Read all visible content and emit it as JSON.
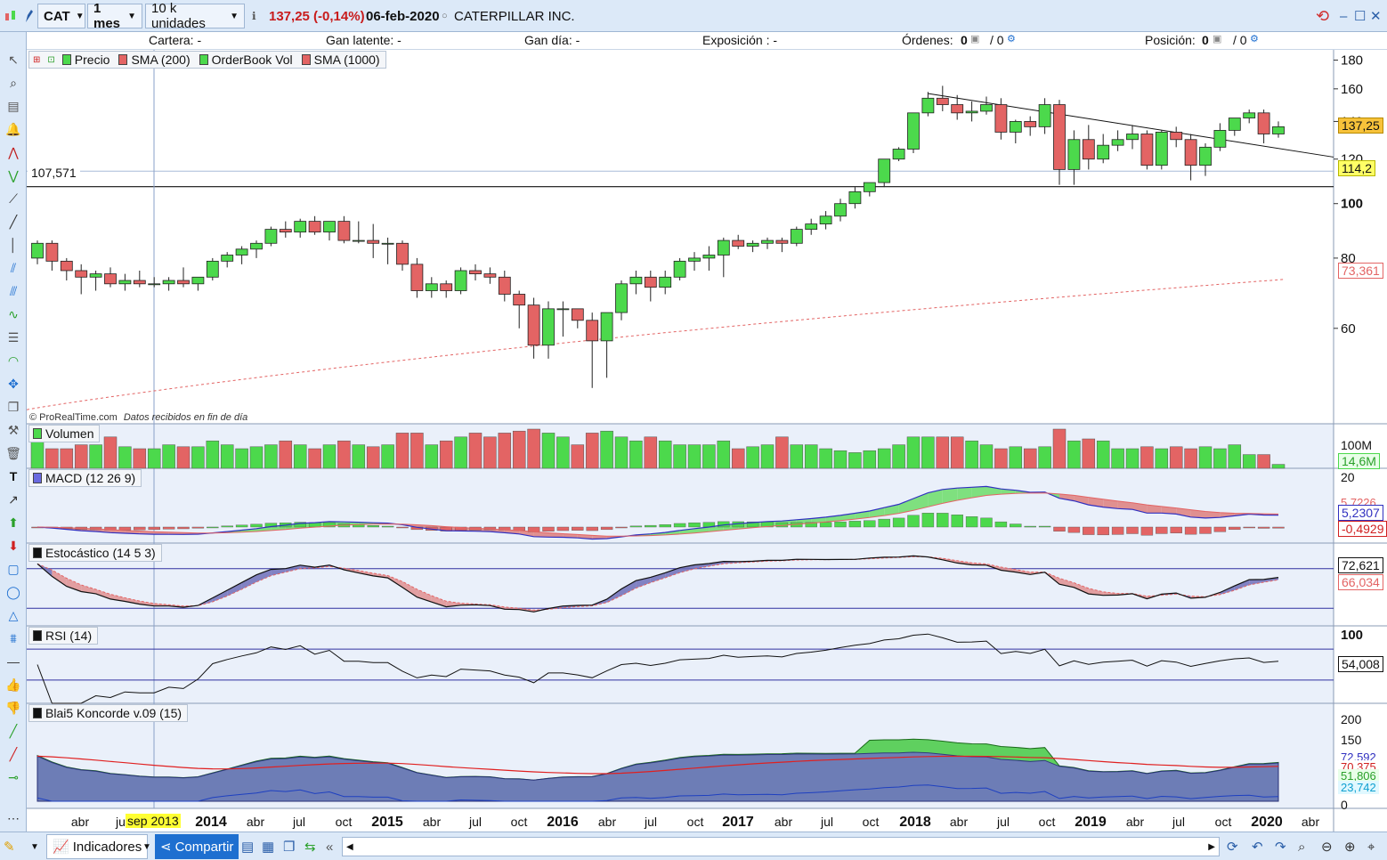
{
  "toolbar": {
    "symbol": "CAT",
    "timeframe": "1 mes",
    "units": "10 k unidades",
    "price_change": "137,25 (-0,14%)",
    "date": "06-feb-2020",
    "instrument": "CATERPILLAR INC."
  },
  "infobar": {
    "cartera": "Cartera: -",
    "gan_latente": "Gan latente: -",
    "gan_dia": "Gan día: -",
    "exposicion": "Exposición : -",
    "ordenes_label": "Órdenes:",
    "ordenes_a": "0",
    "ordenes_b": "/ 0",
    "posicion_label": "Posición:",
    "posicion_a": "0",
    "posicion_b": "/ 0"
  },
  "legend_price": {
    "precio": "Precio",
    "sma200": "SMA (200)",
    "orderbook": "OrderBook Vol",
    "sma1000": "SMA (1000)"
  },
  "price_panel": {
    "yticks": [
      "180",
      "160",
      "140",
      "120",
      "100",
      "80",
      "60"
    ],
    "hline_label": "107,571",
    "last_price": "137,25",
    "level_114": "114,2",
    "sma_value": "73,361",
    "watermark": "© ProRealTime.com",
    "watermark_sub": "Datos recibidos en fin de día"
  },
  "volume_panel": {
    "title": "Volumen",
    "ytick": "100M",
    "value": "14,6M"
  },
  "macd_panel": {
    "title": "MACD (12 26 9)",
    "ytick": "20",
    "v1": "5,7226",
    "v2": "5,2307",
    "v3": "-0,4929"
  },
  "stoch_panel": {
    "title": "Estocástico (14 5 3)",
    "v1": "72,621",
    "v2": "66,034"
  },
  "rsi_panel": {
    "title": "RSI (14)",
    "ytick": "100",
    "value": "54,008"
  },
  "koncorde_panel": {
    "title": "Blai5 Koncorde v.09 (15)",
    "yticks": [
      "200",
      "150",
      "0"
    ],
    "v1": "72,592",
    "v2": "70,375",
    "v3": "51,806",
    "v4": "23,742"
  },
  "xaxis": {
    "labels": [
      "abr",
      "jul",
      "2014",
      "abr",
      "jul",
      "oct",
      "2015",
      "abr",
      "jul",
      "oct",
      "2016",
      "abr",
      "jul",
      "oct",
      "2017",
      "abr",
      "jul",
      "oct",
      "2018",
      "abr",
      "jul",
      "oct",
      "2019",
      "abr",
      "jul",
      "oct",
      "2020",
      "abr"
    ],
    "cursor_label": "sep 2013"
  },
  "bottombar": {
    "indicadores": "Indicadores",
    "compartir": "Compartir"
  },
  "colors": {
    "up": "#4cd94c",
    "down": "#e36464",
    "accent": "#1e6fd0"
  },
  "chart_data": {
    "type": "candlestick",
    "title": "",
    "ylim": [
      40,
      185
    ],
    "ohlc": [
      [
        80,
        86,
        78,
        85
      ],
      [
        85,
        86,
        76,
        79
      ],
      [
        79,
        80,
        73,
        76
      ],
      [
        76,
        78,
        69,
        74
      ],
      [
        74,
        76,
        70,
        75
      ],
      [
        75,
        77,
        71,
        72
      ],
      [
        72,
        75,
        70,
        73
      ],
      [
        73,
        76,
        71,
        72
      ],
      [
        72,
        74,
        71,
        72
      ],
      [
        72,
        74,
        70,
        73
      ],
      [
        73,
        77,
        71,
        72
      ],
      [
        72,
        74,
        70,
        74
      ],
      [
        74,
        80,
        73,
        79
      ],
      [
        79,
        82,
        77,
        81
      ],
      [
        81,
        84,
        78,
        83
      ],
      [
        83,
        86,
        80,
        85
      ],
      [
        85,
        91,
        84,
        90
      ],
      [
        90,
        93,
        87,
        89
      ],
      [
        89,
        94,
        87,
        93
      ],
      [
        93,
        95,
        88,
        89
      ],
      [
        89,
        93,
        86,
        93
      ],
      [
        93,
        95,
        85,
        86
      ],
      [
        86,
        93,
        85,
        86
      ],
      [
        86,
        92,
        80,
        85
      ],
      [
        85,
        87,
        78,
        85
      ],
      [
        85,
        86,
        76,
        78
      ],
      [
        78,
        80,
        68,
        70
      ],
      [
        70,
        74,
        68,
        72
      ],
      [
        72,
        73,
        68,
        70
      ],
      [
        70,
        77,
        69,
        76
      ],
      [
        76,
        78,
        73,
        75
      ],
      [
        75,
        77,
        72,
        74
      ],
      [
        74,
        76,
        67,
        69
      ],
      [
        69,
        70,
        60,
        66
      ],
      [
        66,
        68,
        53,
        56
      ],
      [
        56,
        67,
        53,
        65
      ],
      [
        65,
        67,
        58,
        65
      ],
      [
        65,
        64,
        60,
        62
      ],
      [
        62,
        64,
        47,
        57
      ],
      [
        57,
        64,
        49,
        64
      ],
      [
        64,
        73,
        62,
        72
      ],
      [
        72,
        76,
        69,
        74
      ],
      [
        74,
        76,
        67,
        71
      ],
      [
        71,
        76,
        69,
        74
      ],
      [
        74,
        80,
        73,
        79
      ],
      [
        79,
        82,
        76,
        80
      ],
      [
        80,
        84,
        76,
        81
      ],
      [
        81,
        87,
        74,
        86
      ],
      [
        86,
        88,
        83,
        84
      ],
      [
        84,
        86,
        82,
        85
      ],
      [
        85,
        87,
        83,
        86
      ],
      [
        86,
        87,
        82,
        85
      ],
      [
        85,
        91,
        84,
        90
      ],
      [
        90,
        94,
        88,
        92
      ],
      [
        92,
        97,
        90,
        95
      ],
      [
        95,
        102,
        93,
        100
      ],
      [
        100,
        107,
        98,
        105
      ],
      [
        105,
        109,
        103,
        109
      ],
      [
        109,
        120,
        107,
        120
      ],
      [
        120,
        126,
        119,
        125
      ],
      [
        125,
        143,
        123,
        145
      ],
      [
        145,
        158,
        143,
        154
      ],
      [
        154,
        162,
        146,
        150
      ],
      [
        150,
        156,
        141,
        145
      ],
      [
        145,
        152,
        140,
        146
      ],
      [
        146,
        155,
        144,
        150
      ],
      [
        150,
        154,
        130,
        134
      ],
      [
        134,
        141,
        128,
        140
      ],
      [
        140,
        143,
        132,
        137
      ],
      [
        137,
        154,
        133,
        150
      ],
      [
        150,
        153,
        108,
        115
      ],
      [
        115,
        135,
        108,
        130
      ],
      [
        130,
        138,
        115,
        120
      ],
      [
        120,
        133,
        118,
        127
      ],
      [
        127,
        135,
        124,
        130
      ],
      [
        130,
        138,
        125,
        133
      ],
      [
        133,
        135,
        115,
        117
      ],
      [
        117,
        135,
        115,
        134
      ],
      [
        134,
        137,
        126,
        130
      ],
      [
        130,
        133,
        110,
        117
      ],
      [
        117,
        128,
        112,
        126
      ],
      [
        126,
        139,
        124,
        135
      ],
      [
        135,
        141,
        132,
        142
      ],
      [
        142,
        147,
        139,
        145
      ],
      [
        145,
        147,
        128,
        133
      ],
      [
        133,
        140,
        131,
        137
      ]
    ],
    "volume_rel": [
      0.7,
      0.5,
      0.5,
      0.6,
      0.6,
      0.8,
      0.55,
      0.5,
      0.5,
      0.6,
      0.55,
      0.55,
      0.7,
      0.6,
      0.5,
      0.55,
      0.6,
      0.7,
      0.6,
      0.5,
      0.6,
      0.7,
      0.6,
      0.55,
      0.6,
      0.9,
      0.9,
      0.6,
      0.7,
      0.8,
      0.9,
      0.8,
      0.9,
      0.95,
      1.0,
      0.9,
      0.8,
      0.6,
      0.9,
      0.95,
      0.8,
      0.7,
      0.8,
      0.7,
      0.6,
      0.6,
      0.6,
      0.7,
      0.5,
      0.55,
      0.6,
      0.8,
      0.6,
      0.6,
      0.5,
      0.45,
      0.4,
      0.45,
      0.5,
      0.6,
      0.8,
      0.8,
      0.8,
      0.8,
      0.7,
      0.6,
      0.5,
      0.55,
      0.5,
      0.55,
      1.0,
      0.7,
      0.75,
      0.7,
      0.5,
      0.5,
      0.55,
      0.5,
      0.55,
      0.5,
      0.55,
      0.5,
      0.6,
      0.35,
      0.35,
      0.1
    ]
  }
}
